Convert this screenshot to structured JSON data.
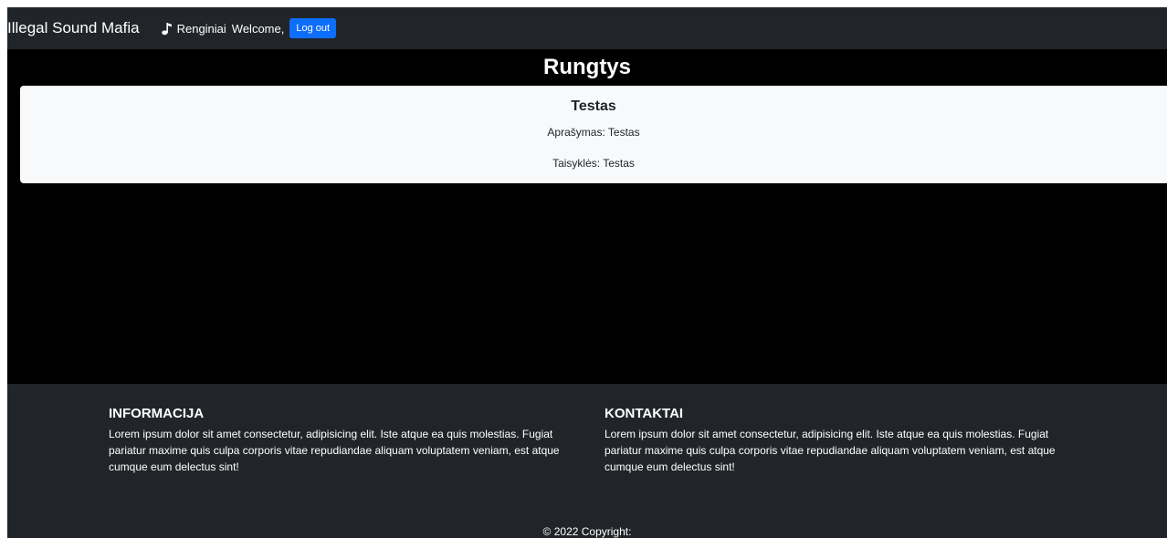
{
  "navbar": {
    "brand": "Illegal Sound Mafia",
    "events_link": "Renginiai",
    "events_icon": "music-note-icon",
    "welcome_text": "Welcome,",
    "logout_label": "Log out"
  },
  "main": {
    "title": "Rungtys",
    "cards": [
      {
        "title": "Testas",
        "description": "Aprašymas: Testas",
        "rules": "Taisyklės: Testas"
      }
    ]
  },
  "footer": {
    "info_heading": "INFORMACIJA",
    "info_text": "Lorem ipsum dolor sit amet consectetur, adipisicing elit. Iste atque ea quis molestias. Fugiat pariatur maxime quis culpa corporis vitae repudiandae aliquam voluptatem veniam, est atque cumque eum delectus sint!",
    "contacts_heading": "KONTAKTAI",
    "contacts_text": "Lorem ipsum dolor sit amet consectetur, adipisicing elit. Iste atque ea quis molestias. Fugiat pariatur maxime quis culpa corporis vitae repudiandae aliquam voluptatem veniam, est atque cumque eum delectus sint!",
    "copyright": "© 2022 Copyright:"
  },
  "colors": {
    "navbar_bg": "#212529",
    "main_bg": "#000000",
    "card_bg": "#f8f9fa",
    "logout_button": "#0d6efd",
    "footer_bg": "#212529"
  }
}
